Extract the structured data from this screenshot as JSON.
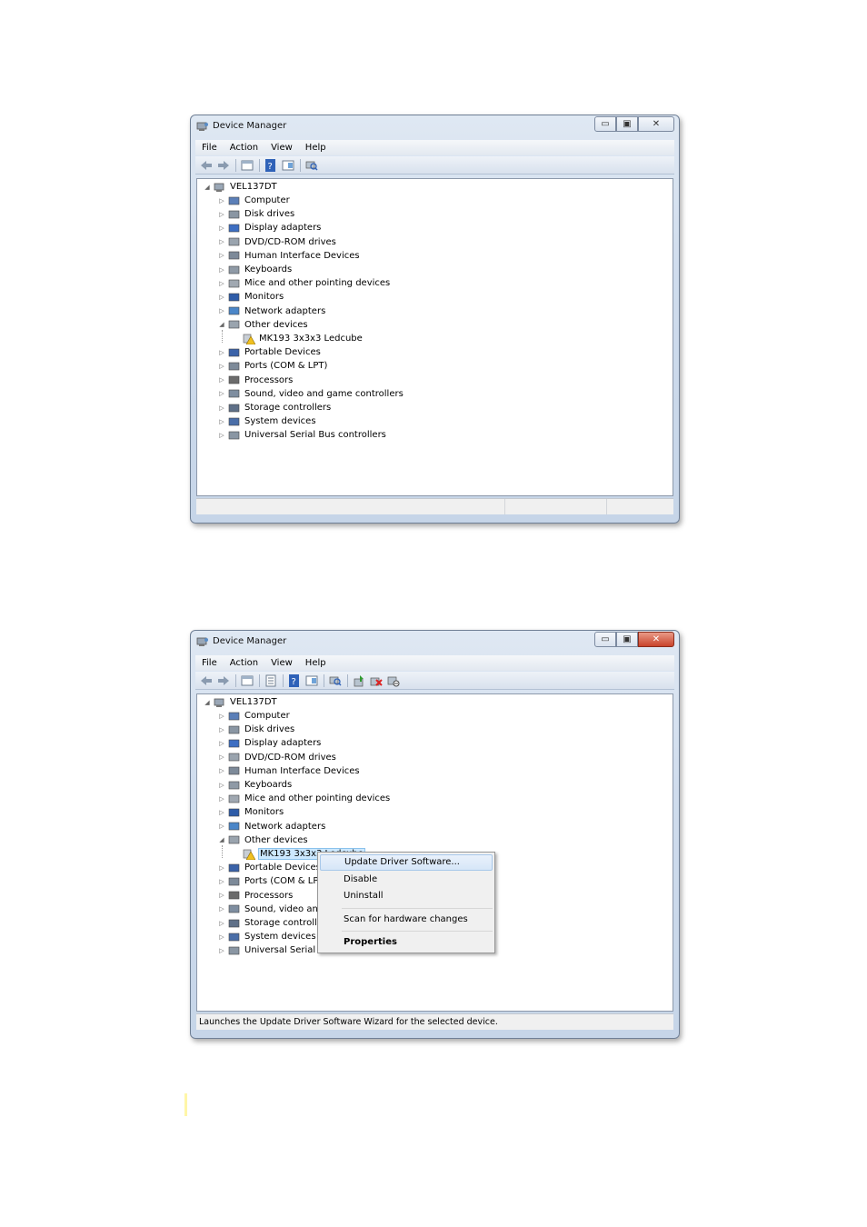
{
  "window": {
    "title": "Device Manager",
    "controls": {
      "minimize": "▭",
      "maximize": "▣",
      "close": "✕"
    }
  },
  "menu": [
    "File",
    "Action",
    "View",
    "Help"
  ],
  "tree": {
    "root": "VEL137DT",
    "categories": [
      "Computer",
      "Disk drives",
      "Display adapters",
      "DVD/CD-ROM drives",
      "Human Interface Devices",
      "Keyboards",
      "Mice and other pointing devices",
      "Monitors",
      "Network adapters",
      "Other devices",
      "MK193 3x3x3 Ledcube",
      "Portable Devices",
      "Ports (COM & LPT)",
      "Processors",
      "Sound, video and game controllers",
      "Storage controllers",
      "System devices",
      "Universal Serial Bus controllers"
    ],
    "categories_truncated": [
      "Computer",
      "Disk drives",
      "Display adapters",
      "DVD/CD-ROM drives",
      "Human Interface Devices",
      "Keyboards",
      "Mice and other pointing devices",
      "Monitors",
      "Network adapters",
      "Other devices",
      "MK193 3x3x3 Ledcube",
      "Portable Devices",
      "Ports (COM & LPT)",
      "Processors",
      "Sound, video and",
      "Storage controller",
      "System devices",
      "Universal Serial Bu"
    ]
  },
  "context_menu": {
    "items": [
      "Update Driver Software...",
      "Disable",
      "Uninstall",
      "Scan for hardware changes",
      "Properties"
    ]
  },
  "status": {
    "window2": "Launches the Update Driver Software Wizard for the selected device."
  },
  "icons": {
    "toolbar1": [
      "back-arrow-icon",
      "forward-arrow-icon",
      "show-hide-tree-icon",
      "help-icon",
      "action-pane-icon",
      "scan-hardware-icon"
    ],
    "toolbar2": [
      "back-arrow-icon",
      "forward-arrow-icon",
      "show-hide-tree-icon",
      "properties-icon",
      "help-icon",
      "action-pane-icon",
      "scan-hardware-icon",
      "update-driver-icon",
      "uninstall-icon",
      "disable-icon"
    ]
  }
}
